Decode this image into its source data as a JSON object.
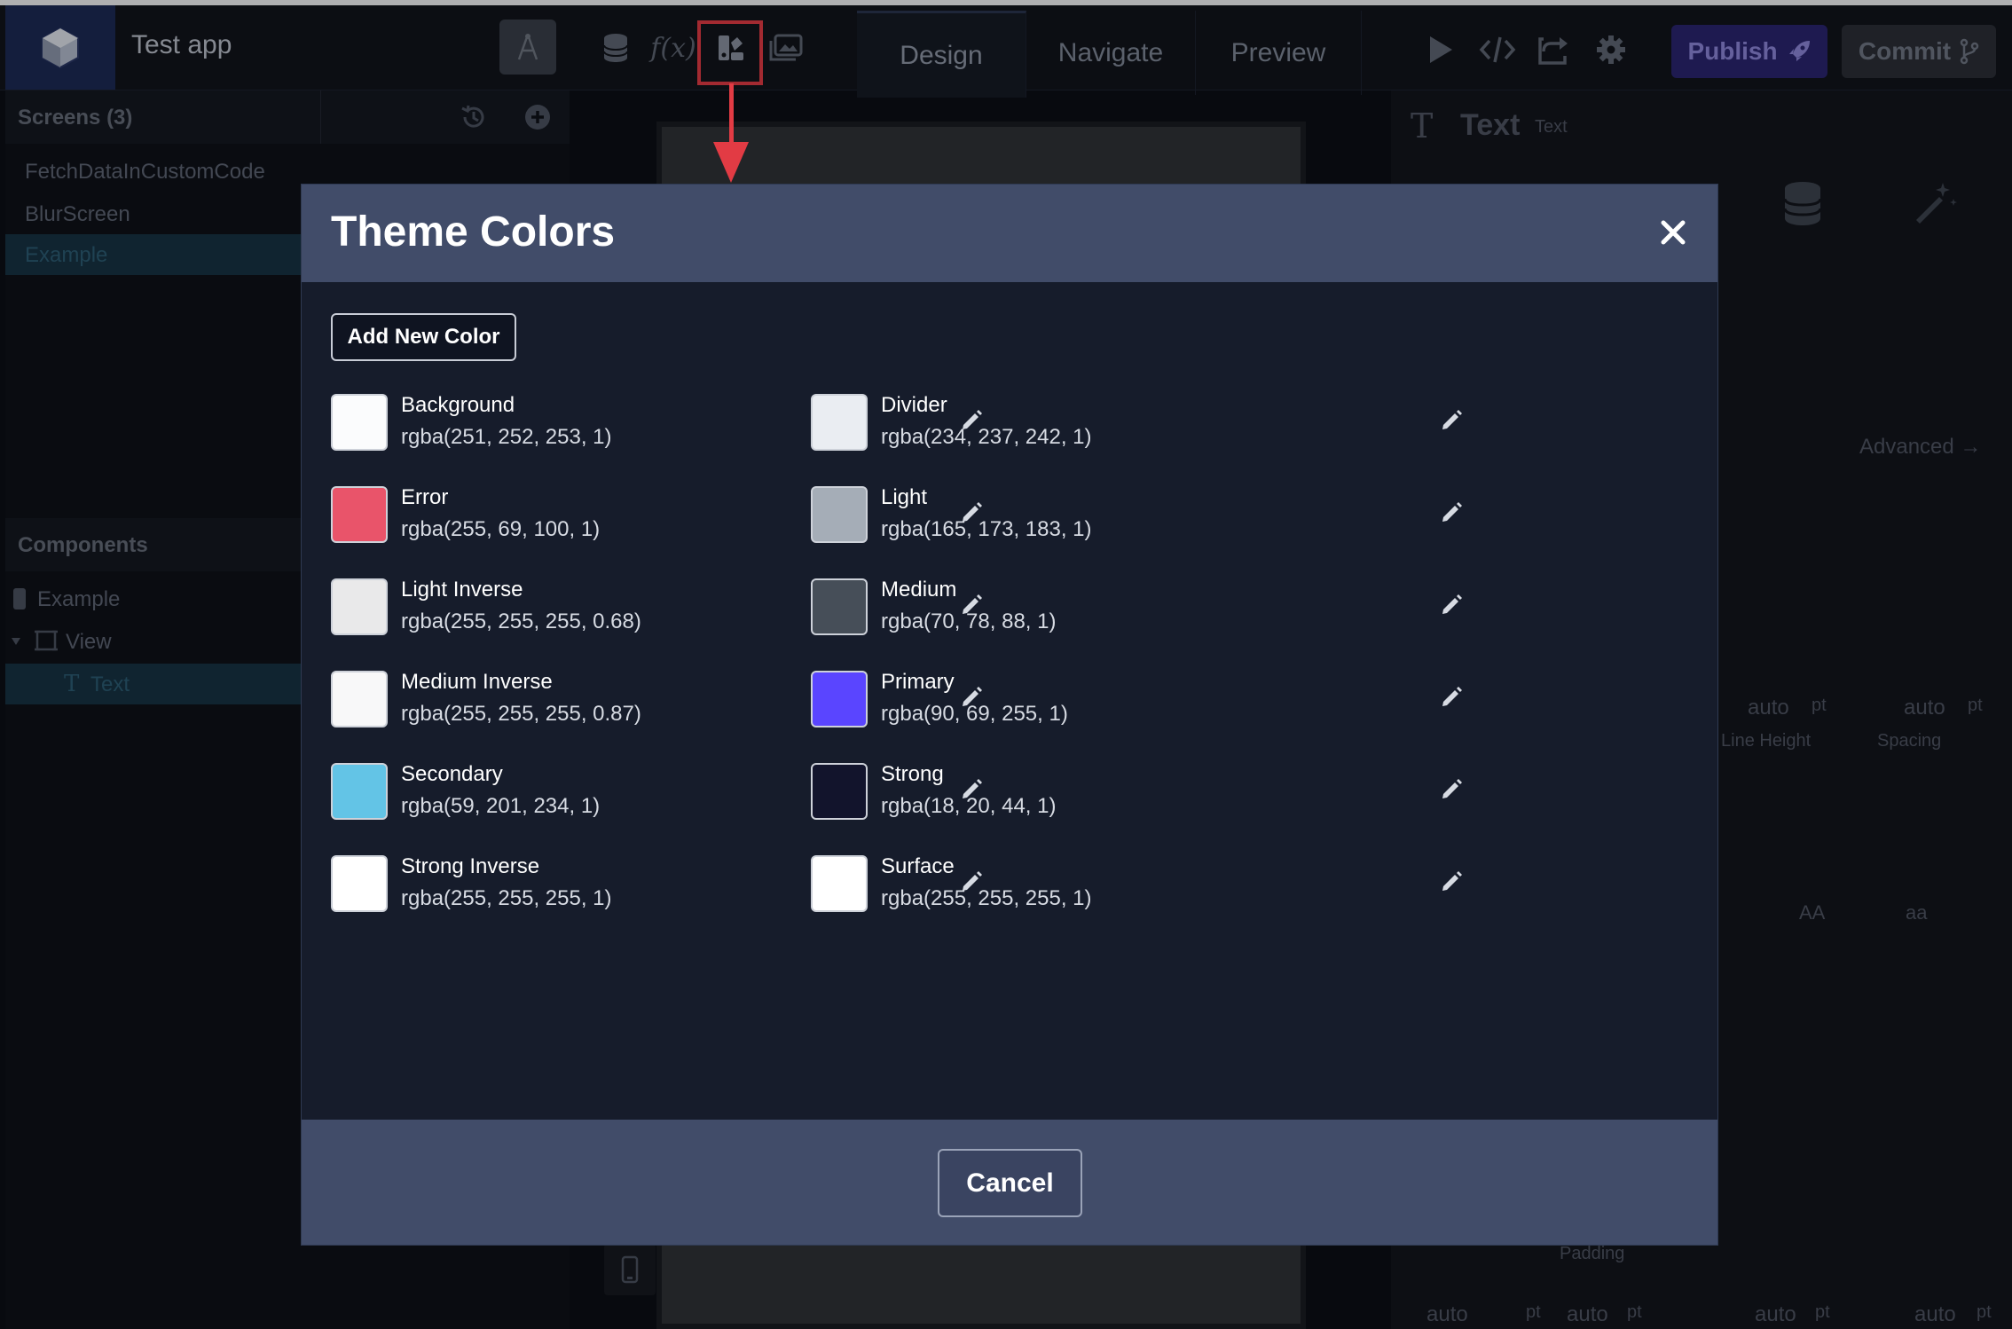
{
  "app": {
    "name": "Test app"
  },
  "tabs": [
    {
      "label": "Design"
    },
    {
      "label": "Navigate"
    },
    {
      "label": "Preview"
    }
  ],
  "toolbar": {
    "publish_label": "Publish",
    "commit_label": "Commit"
  },
  "left_panel": {
    "screens_title": "Screens (3)",
    "screens": [
      {
        "label": "FetchDataInCustomCode"
      },
      {
        "label": "BlurScreen"
      },
      {
        "label": "Example"
      }
    ],
    "components_title": "Components",
    "components": [
      {
        "label": "Example"
      },
      {
        "label": "View"
      },
      {
        "label": "Text"
      }
    ]
  },
  "right_panel": {
    "title": "Text",
    "subtitle": "Text",
    "advanced_label": "Advanced →",
    "line_height_label": "Line Height",
    "spacing_label": "Spacing",
    "padding_label": "Padding",
    "auto": "auto",
    "pt": "pt",
    "case_upper": "AA",
    "case_lower": "aa"
  },
  "modal": {
    "title": "Theme Colors",
    "add_label": "Add New Color",
    "cancel_label": "Cancel",
    "colors_left": [
      {
        "name": "Background",
        "value": "rgba(251, 252, 253, 1)",
        "hex": "#fbfcfd"
      },
      {
        "name": "Error",
        "value": "rgba(255, 69, 100, 1)",
        "hex": "#e9546a"
      },
      {
        "name": "Light Inverse",
        "value": "rgba(255, 255, 255, 0.68)",
        "hex": "#e9e9ea"
      },
      {
        "name": "Medium Inverse",
        "value": "rgba(255, 255, 255, 0.87)",
        "hex": "#f8f8f9"
      },
      {
        "name": "Secondary",
        "value": "rgba(59, 201, 234, 1)",
        "hex": "#63c4e6"
      },
      {
        "name": "Strong Inverse",
        "value": "rgba(255, 255, 255, 1)",
        "hex": "#ffffff"
      }
    ],
    "colors_right": [
      {
        "name": "Divider",
        "value": "rgba(234, 237, 242, 1)",
        "hex": "#eaedf2"
      },
      {
        "name": "Light",
        "value": "rgba(165, 173, 183, 1)",
        "hex": "#a5adb7"
      },
      {
        "name": "Medium",
        "value": "rgba(70, 78, 88, 1)",
        "hex": "#464e58"
      },
      {
        "name": "Primary",
        "value": "rgba(90, 69, 255, 1)",
        "hex": "#5a45ff"
      },
      {
        "name": "Strong",
        "value": "rgba(18, 20, 44, 1)",
        "hex": "#12142c"
      },
      {
        "name": "Surface",
        "value": "rgba(255, 255, 255, 1)",
        "hex": "#ffffff"
      }
    ]
  },
  "annotation_color": "#e23b44"
}
